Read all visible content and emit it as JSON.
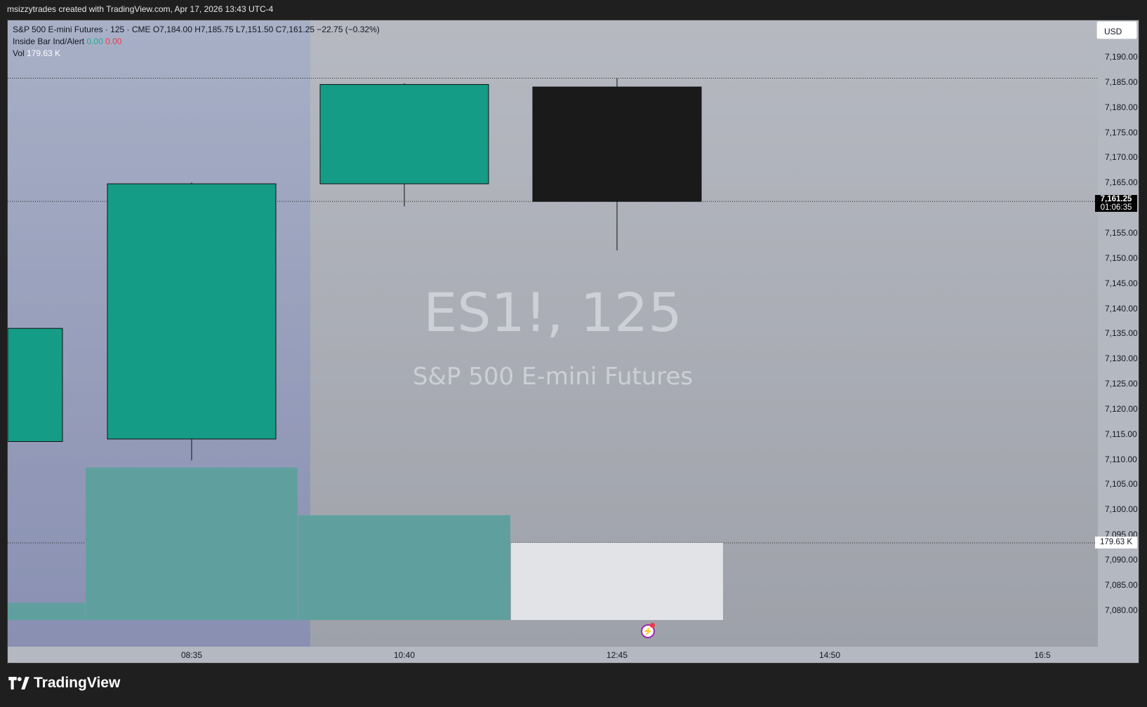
{
  "header": {
    "attribution": "msizzytrades created with TradingView.com, Apr 17, 2026 13:43 UTC-4"
  },
  "legend": {
    "symbol_line": "S&P 500 E-mini Futures · 125 · CME  O7,184.00  H7,185.75  L7,151.50  C7,161.25  −22.75 (−0.32%)",
    "indicator_name": "Inside Bar Ind/Alert",
    "indicator_val1": "0.00",
    "indicator_val2": "0.00",
    "vol_label": "Vol",
    "vol_value": "179.63 K"
  },
  "currency_button": "USD",
  "watermark": {
    "title": "ES1!, 125",
    "subtitle": "S&P 500 E-mini Futures"
  },
  "last_price": {
    "price": "7,161.25",
    "countdown": "01:06:35"
  },
  "volume_axis_label": "179.63 K",
  "footer": {
    "brand": "TradingView"
  },
  "colors": {
    "up": "#159c86",
    "down": "#1a1a1a",
    "volume": "#5fa09f",
    "volume_current": "#e2e3e7",
    "session_shade": "#8f9bc4"
  },
  "icons": {
    "alert": "lightning-alert-icon",
    "logo": "tradingview-logo-icon"
  },
  "chart_data": {
    "type": "candlestick",
    "title": "ES1!, 125",
    "subtitle": "S&P 500 E-mini Futures",
    "ylim": [
      7077,
      7195
    ],
    "y_ticks": [
      7190,
      7185,
      7180,
      7175,
      7170,
      7165,
      7155,
      7150,
      7145,
      7140,
      7135,
      7130,
      7125,
      7120,
      7115,
      7110,
      7105,
      7100,
      7095,
      7090,
      7085,
      7080
    ],
    "y_tick_labels": [
      "7,190.00",
      "7,185.00",
      "7,180.00",
      "7,175.00",
      "7,170.00",
      "7,165.00",
      "7,155.00",
      "7,150.00",
      "7,145.00",
      "7,140.00",
      "7,135.00",
      "7,130.00",
      "7,125.00",
      "7,120.00",
      "7,115.00",
      "7,110.00",
      "7,105.00",
      "7,100.00",
      "7,095.00",
      "7,090.00",
      "7,085.00",
      "7,080.00"
    ],
    "x_ticks": [
      "08:35",
      "10:40",
      "12:45",
      "14:50",
      "16:5"
    ],
    "candles": [
      {
        "open": 7113.5,
        "close": 7136.0,
        "high": 7136.0,
        "low": 7113.5
      },
      {
        "open": 7114.0,
        "close": 7164.75,
        "high": 7165.0,
        "low": 7109.75
      },
      {
        "open": 7164.75,
        "close": 7184.5,
        "high": 7184.75,
        "low": 7160.25
      },
      {
        "open": 7184.0,
        "close": 7161.25,
        "high": 7185.75,
        "low": 7151.5
      }
    ],
    "volume": [
      {
        "value": 40,
        "note": "partial"
      },
      {
        "value": 355
      },
      {
        "value": 244
      },
      {
        "value": 179.63
      }
    ],
    "volume_unit": "K",
    "grid": false,
    "reference_lines": [
      {
        "kind": "high",
        "value": 7185.75
      },
      {
        "kind": "last",
        "value": 7161.25
      }
    ]
  }
}
